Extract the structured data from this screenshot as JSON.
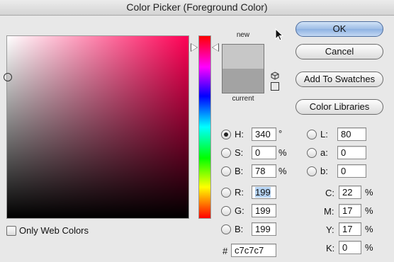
{
  "window": {
    "title": "Color Picker (Foreground Color)"
  },
  "preview": {
    "new_label": "new",
    "current_label": "current",
    "new_color": "#c7c7c7",
    "current_color": "#a3a3a3"
  },
  "buttons": {
    "ok": "OK",
    "cancel": "Cancel",
    "add_to_swatches": "Add To Swatches",
    "color_libraries": "Color Libraries"
  },
  "hsb": {
    "h_label": "H:",
    "h_value": "340",
    "h_unit": "°",
    "s_label": "S:",
    "s_value": "0",
    "s_unit": "%",
    "b_label": "B:",
    "b_value": "78",
    "b_unit": "%"
  },
  "rgb": {
    "r_label": "R:",
    "r_value": "199",
    "g_label": "G:",
    "g_value": "199",
    "b_label": "B:",
    "b_value": "199"
  },
  "lab": {
    "l_label": "L:",
    "l_value": "80",
    "a_label": "a:",
    "a_value": "0",
    "b_label": "b:",
    "b_value": "0"
  },
  "cmyk": {
    "c_label": "C:",
    "c_value": "22",
    "c_unit": "%",
    "m_label": "M:",
    "m_value": "17",
    "m_unit": "%",
    "y_label": "Y:",
    "y_value": "17",
    "y_unit": "%",
    "k_label": "K:",
    "k_value": "0",
    "k_unit": "%"
  },
  "hex": {
    "label": "#",
    "value": "c7c7c7"
  },
  "options": {
    "only_web_colors_label": "Only Web Colors",
    "only_web_colors_checked": false
  },
  "hue_color": "#ff0055",
  "selected_mode": "H"
}
